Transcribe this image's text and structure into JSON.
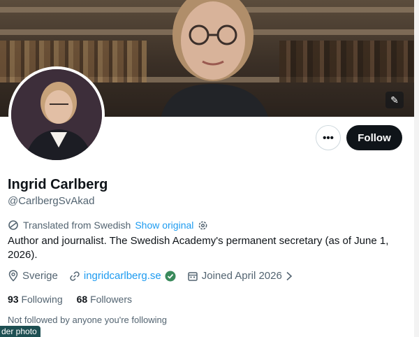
{
  "profile": {
    "name": "Ingrid Carlberg",
    "handle": "@CarlbergSvAkad",
    "translated_label": "Translated from Swedish",
    "show_original_label": "Show original",
    "bio": "Author and journalist. The Swedish Academy's permanent secretary (as of June 1, 2026).",
    "location": "Sverige",
    "website": "ingridcarlberg.se",
    "joined": "Joined April 2026",
    "following_count": "93",
    "following_label": "Following",
    "followers_count": "68",
    "followers_label": "Followers",
    "followed_note": "Not followed by anyone you're following"
  },
  "actions": {
    "more_label": "•••",
    "follow_label": "Follow"
  },
  "tooltip": {
    "text": "der photo"
  },
  "colors": {
    "accent": "#1d9bf0",
    "follow_bg": "#0f1419",
    "muted": "#536471"
  }
}
